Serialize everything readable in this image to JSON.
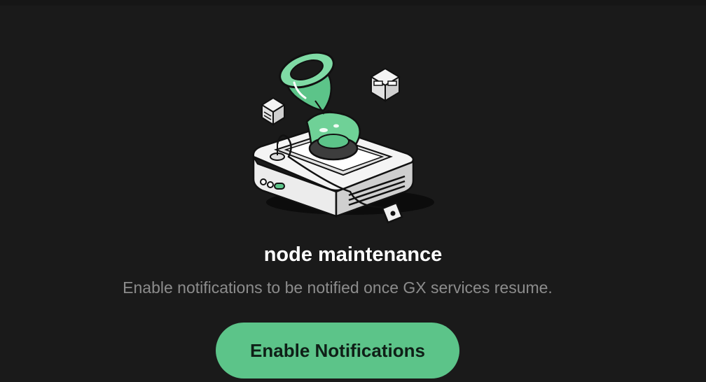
{
  "maintenance": {
    "title": "node maintenance",
    "message": "Enable notifications to be notified once GX services resume.",
    "button_label": "Enable Notifications",
    "illustration_icon": "hourglass-server-icon"
  },
  "colors": {
    "background": "#1a1a1a",
    "accent": "#5cc489",
    "title": "#ffffff",
    "message": "#8c8c8c",
    "button_text": "#0f1f17"
  }
}
